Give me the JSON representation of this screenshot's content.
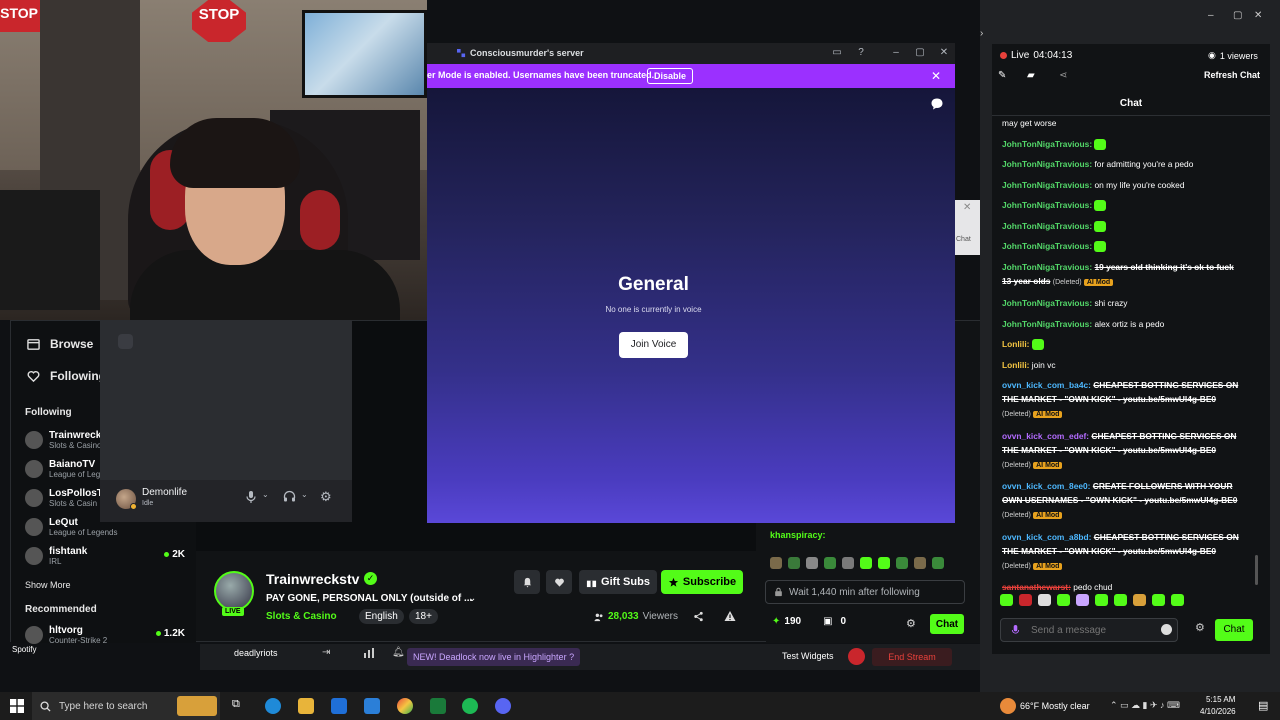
{
  "kick": {
    "sidebar": {
      "browse": "Browse",
      "following_nav": "Following",
      "following_heading": "Following",
      "channels": [
        {
          "name": "Trainwrecks",
          "category": "Slots & Casino",
          "viewers": ""
        },
        {
          "name": "BaianoTV",
          "category": "League of Lege",
          "viewers": ""
        },
        {
          "name": "LosPollosTV",
          "category": "Slots & Casin",
          "viewers": ""
        },
        {
          "name": "LeQut",
          "category": "League of Legends",
          "viewers": ""
        },
        {
          "name": "fishtank",
          "category": "IRL",
          "viewers": "2K"
        }
      ],
      "show_more": "Show More",
      "recommended_heading": "Recommended",
      "recommended": [
        {
          "name": "hltvorg",
          "category": "Counter-Strike 2",
          "viewers": "1.2K"
        }
      ]
    },
    "channel": {
      "name": "Trainwreckstv",
      "title": "PAY GONE, PERSONAL ONLY (outside of ...",
      "category": "Slots & Casino",
      "language": "English",
      "rating": "18+",
      "live_tag": "LIVE",
      "gift_subs": "Gift Subs",
      "subscribe": "Subscribe",
      "viewers_num": "28,033",
      "viewers_label": "Viewers"
    },
    "chat": {
      "line_user": "khanspiracy:",
      "wait_text": "Wait 1,440 min after following",
      "points": "190",
      "store_count": "0",
      "chat_button": "Chat"
    }
  },
  "discord": {
    "window_title": "Consciousmurder's server",
    "banner_text": "er Mode is enabled. Usernames have been truncated.",
    "banner_disable": "Disable",
    "voice_channel": "General",
    "voice_subtitle": "No one is currently in voice",
    "join_voice": "Join Voice",
    "popout_label": "Chat",
    "user": {
      "name": "Demonlife",
      "status": "Idle"
    }
  },
  "chatpanel": {
    "live_label": "Live",
    "uptime": "04:04:13",
    "viewers": "1 viewers",
    "refresh": "Refresh Chat",
    "header": "Chat",
    "messages": [
      {
        "user": "",
        "text": "may get worse",
        "color": "#ffffff"
      },
      {
        "user": "JohnTonNigaTravious:",
        "text": "",
        "emote": true,
        "color": "#53d769"
      },
      {
        "user": "JohnTonNigaTravious:",
        "text": "for admitting you're a pedo",
        "color": "#53d769"
      },
      {
        "user": "JohnTonNigaTravious:",
        "text": "on my life you're cooked",
        "color": "#53d769"
      },
      {
        "user": "JohnTonNigaTravious:",
        "text": "",
        "emote": true,
        "color": "#53d769"
      },
      {
        "user": "JohnTonNigaTravious:",
        "text": "",
        "emote": true,
        "color": "#53d769"
      },
      {
        "user": "JohnTonNigaTravious:",
        "text": "",
        "emote": true,
        "color": "#53d769"
      },
      {
        "user": "JohnTonNigaTravious:",
        "text": "19 years old thinking it's ok to fuck 13 year olds",
        "deleted": true,
        "color": "#53d769"
      },
      {
        "user": "JohnTonNigaTravious:",
        "text": "shi crazy",
        "color": "#53d769"
      },
      {
        "user": "JohnTonNigaTravious:",
        "text": "alex ortiz is a pedo",
        "color": "#53d769"
      },
      {
        "user": "Lonlili:",
        "text": "",
        "emote": true,
        "color": "#f5c542"
      },
      {
        "user": "Lonlili:",
        "text": "join vc",
        "color": "#f5c542"
      },
      {
        "user": "ovvn_kick_com_ba4c:",
        "text": "CHEAPEST BOTTING SERVICES ON THE MARKET - \"OWN KICK\" - youtu.be/5mwUl4g-BE0",
        "deleted": true,
        "color": "#4db8ff"
      },
      {
        "user": "ovvn_kick_com_edef:",
        "text": "CHEAPEST BOTTING SERVICES ON THE MARKET - \"OWN KICK\" - youtu.be/5mwUl4g-BE0",
        "deleted": true,
        "color": "#b36bff"
      },
      {
        "user": "ovvn_kick_com_8ee0:",
        "text": "CREATE FOLLOWERS WITH YOUR OWN USERNAMES - \"OWN KICK\" - youtu.be/5mwUl4g-BE0",
        "deleted": true,
        "color": "#4db8ff"
      },
      {
        "user": "ovvn_kick_com_a8bd:",
        "text": "CHEAPEST BOTTING SERVICES ON THE MARKET - \"OWN KICK\" - youtu.be/5mwUl4g-BE0",
        "deleted": true,
        "color": "#4db8ff"
      },
      {
        "user": "santanathewarst:",
        "text": "pedo chud",
        "strike_user": true,
        "color": "#e8413b"
      }
    ],
    "deleted_label": "(Deleted)",
    "aimod_label": "AI Mod",
    "send_placeholder": "Send a message",
    "send_button": "Chat"
  },
  "obs": {
    "spotify": "Spotify",
    "deadly": "deadlyriots",
    "highlighter": "NEW! Deadlock now live in Highlighter ?",
    "test_widgets": "Test Widgets",
    "end_stream": "End Stream"
  },
  "taskbar": {
    "search_placeholder": "Type here to search",
    "weather": "66°F  Mostly clear",
    "time": "5:15 AM",
    "date": "4/10/2026"
  },
  "webcam": {
    "stop_sign": "STOP",
    "stop_sign_left": "STOP"
  },
  "colors": {
    "kick_green": "#53fc18",
    "discord_purple": "#9b30ff",
    "live_red": "#e8413b"
  }
}
